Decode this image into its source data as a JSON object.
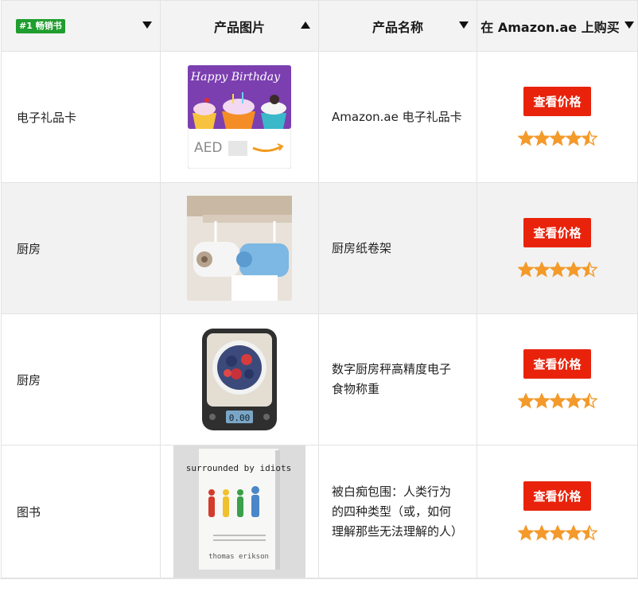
{
  "header": {
    "badge": "#1 畅销书",
    "col_image": "产品图片",
    "col_name": "产品名称",
    "col_buy": "在 Amazon.ae 上购买"
  },
  "colors": {
    "header_bg": "#f3f3f3",
    "alt_row_bg": "#f2f2f2",
    "button_bg": "#e9230b",
    "star_color": "#f39a2b",
    "badge_bg": "#1f9d2e"
  },
  "rows": [
    {
      "category": "电子礼品卡",
      "name": "Amazon.ae 电子礼品卡",
      "button": "查看价格",
      "rating": 4.5,
      "image": {
        "title": "Happy Birthday",
        "currency": "AED"
      }
    },
    {
      "category": "厨房",
      "name": "厨房纸卷架",
      "button": "查看价格",
      "rating": 4.5
    },
    {
      "category": "厨房",
      "name": "数字厨房秤高精度电子食物称重",
      "button": "查看价格",
      "rating": 4.5,
      "image": {
        "display": "0.00"
      }
    },
    {
      "category": "图书",
      "name": "被白痴包围：人类行为的四种类型（或，如何理解那些无法理解的人）",
      "button": "查看价格",
      "rating": 4.5,
      "image": {
        "title": "surrounded by idiots",
        "author": "thomas erikson"
      }
    }
  ]
}
